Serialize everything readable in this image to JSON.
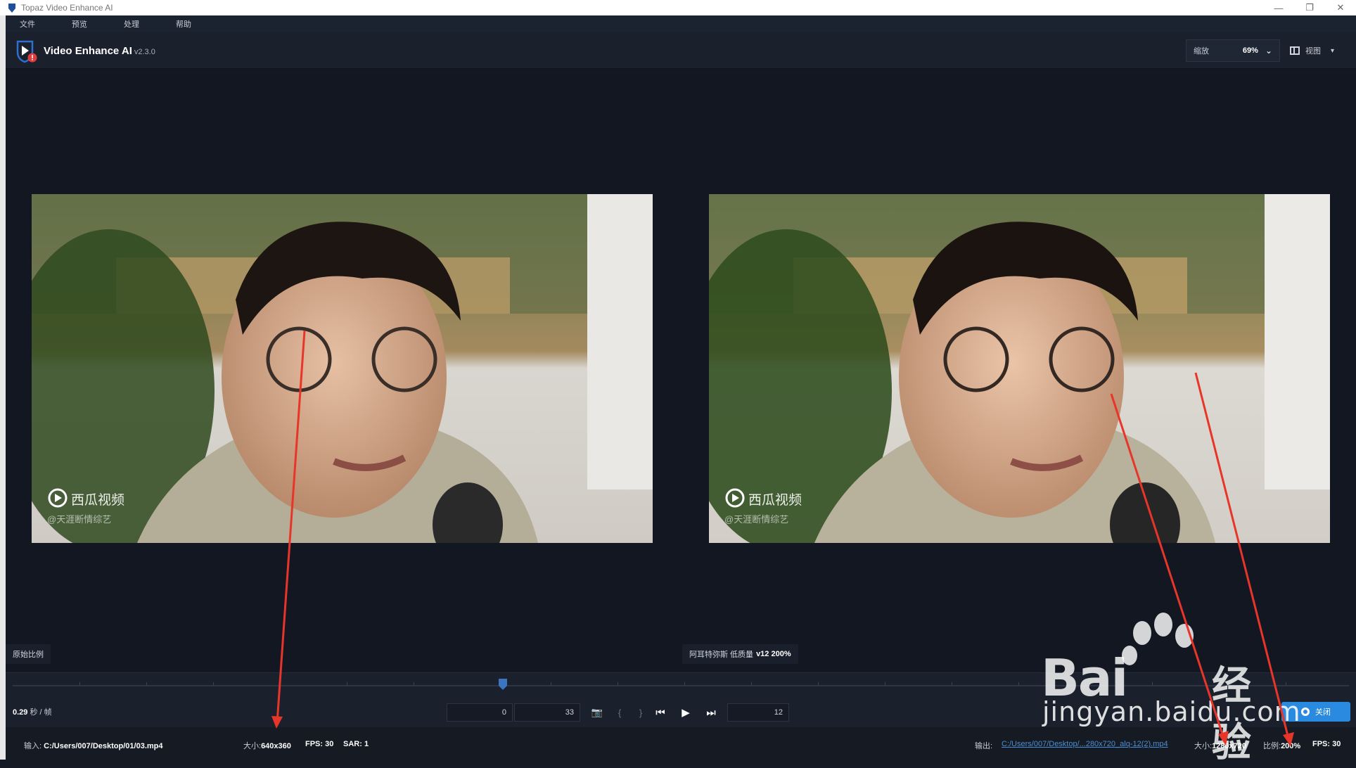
{
  "window": {
    "title": "Topaz Video Enhance AI"
  },
  "menu": [
    "文件",
    "预览",
    "处理",
    "帮助"
  ],
  "header": {
    "app_name": "Video Enhance AI",
    "version": "v2.3.0",
    "zoom_label": "缩放",
    "zoom_value": "69%",
    "view_label": "视图"
  },
  "panes": {
    "left_label": "原始比例",
    "right_label_prefix": "阿耳特弥斯 低质量",
    "right_label_value": "v12 200%",
    "video_watermark_logo": "西瓜视频",
    "video_watermark_user": "@天涯断情综艺"
  },
  "controls": {
    "rate_value": "0.29",
    "rate_unit": "秒 / 帧",
    "start_frame": "0",
    "end_frame": "33",
    "current_frame": "12",
    "stop_label": "关闭"
  },
  "status": {
    "input_label": "输入:",
    "input_path": "C:/Users/007/Desktop/01/03.mp4",
    "input_size_label": "大小:",
    "input_size": "640x360",
    "input_fps_label": "FPS:",
    "input_fps": "30",
    "input_sar_label": "SAR:",
    "input_sar": "1",
    "output_label": "输出:",
    "output_path": "C:/Users/007/Desktop/...280x720_alq-12(2).mp4",
    "output_size_label": "大小:",
    "output_size": "1280x720",
    "output_scale_label": "比例:",
    "output_scale": "200%",
    "output_fps_label": "FPS:",
    "output_fps": "30"
  },
  "watermark": {
    "brand": "Bai",
    "brand_cn": "经验",
    "url": "jingyan.baidu.com"
  },
  "colors": {
    "accent": "#2a8ae0",
    "annotation_arrow": "#e8352a",
    "background": "#121722"
  }
}
